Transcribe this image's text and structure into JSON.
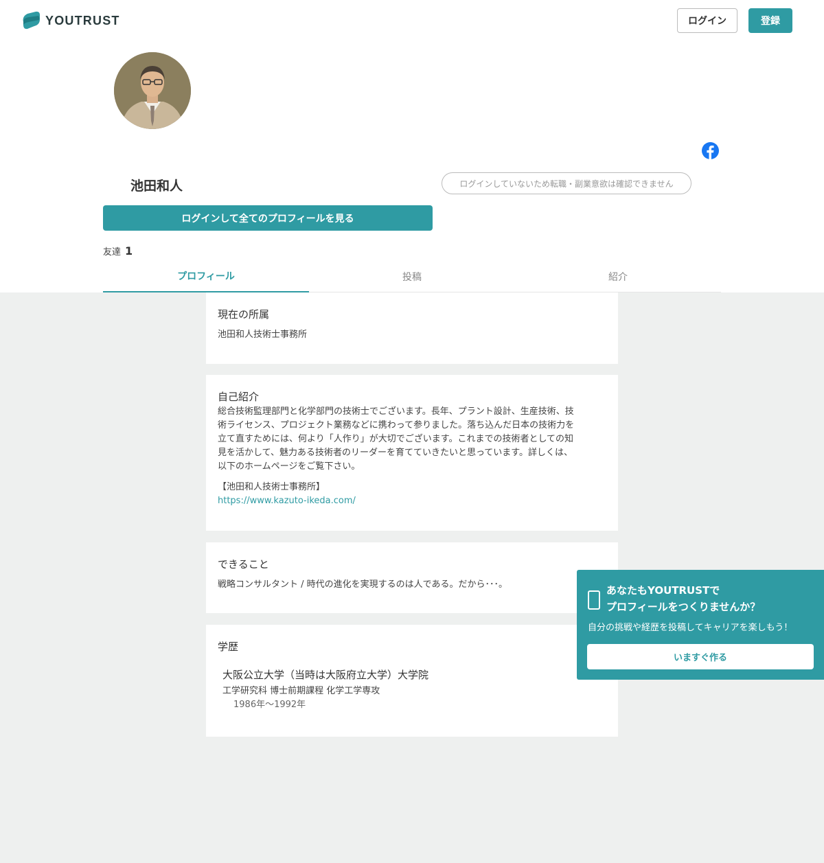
{
  "header": {
    "logo_text": "YOUTRUST",
    "login_label": "ログイン",
    "register_label": "登録"
  },
  "profile": {
    "name": "池田和人",
    "notice": "ログインしていないため転職・副業意欲は確認できません",
    "view_all_label": "ログインして全てのプロフィールを見る",
    "friends_label": "友達",
    "friends_count": "1"
  },
  "tabs": [
    {
      "label": "プロフィール",
      "active": true
    },
    {
      "label": "投稿",
      "active": false
    },
    {
      "label": "紹介",
      "active": false
    }
  ],
  "sections": {
    "affiliation": {
      "title": "現在の所属",
      "value": "池田和人技術士事務所"
    },
    "intro": {
      "title": "自己紹介",
      "lines": [
        "総合技術監理部門と化学部門の技術士でございます。長年、プラント設計、生産技術、技",
        "術ライセンス、プロジェクト業務などに携わって参りました。落ち込んだ日本の技術力を",
        "立て直すためには、何より「人作り」が大切でございます。これまでの技術者としての知",
        "見を活かして、魅力ある技術者のリーダーを育てていきたいと思っています。詳しくは、",
        "以下のホームページをご覧下さい。"
      ],
      "office_label": "【池田和人技術士事務所】",
      "url": "https://www.kazuto-ikeda.com/"
    },
    "skills": {
      "title": "できること",
      "value": "戦略コンサルタント / 時代の進化を実現するのは人である。だから･･･。"
    },
    "education": {
      "title": "学歴",
      "school": "大阪公立大学（当時は大阪府立大学）大学院",
      "department": "工学研究科 博士前期課程 化学工学専攻",
      "years": "1986年〜1992年"
    }
  },
  "promo": {
    "title_line1": "あなたもYOUTRUSTで",
    "title_line2": "プロフィールをつくりませんか？",
    "subtitle": "自分の挑戦や経歴を投稿してキャリアを楽しもう！",
    "button_label": "いますぐ作る"
  },
  "colors": {
    "accent": "#2f9ba3",
    "background": "#eef0ef",
    "facebook": "#1877f2"
  }
}
